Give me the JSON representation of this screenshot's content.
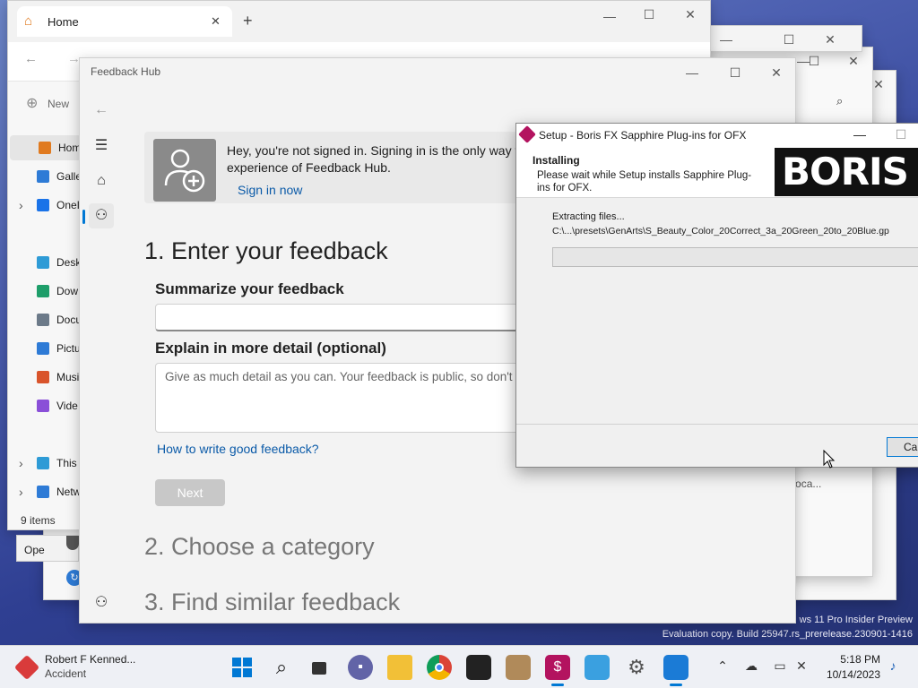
{
  "colors": {
    "accent": "#0078d4",
    "link": "#0a5aa8",
    "boris_bg": "#111111"
  },
  "explorer": {
    "tab_title": "Home",
    "new_label": "New",
    "sidebar": [
      {
        "label": "Home",
        "icon": "home-icon",
        "color": "#e07a1f"
      },
      {
        "label": "Galle",
        "icon": "gallery-icon",
        "color": "#2e7bd6"
      },
      {
        "label": "OneI",
        "icon": "onedrive-icon",
        "color": "#1a73e8"
      },
      {
        "label": "Desk",
        "icon": "desktop-icon",
        "color": "#2e9bd6"
      },
      {
        "label": "Dow",
        "icon": "download-icon",
        "color": "#1e9e6a"
      },
      {
        "label": "Docu",
        "icon": "documents-icon",
        "color": "#6c7a89"
      },
      {
        "label": "Pictu",
        "icon": "pictures-icon",
        "color": "#2e7bd6"
      },
      {
        "label": "Musi",
        "icon": "music-icon",
        "color": "#d9542b"
      },
      {
        "label": "Vide",
        "icon": "videos-icon",
        "color": "#8a4fd8"
      },
      {
        "label": "This",
        "icon": "this-pc-icon",
        "color": "#2e9bd6"
      },
      {
        "label": "Netw",
        "icon": "network-icon",
        "color": "#2e7bd6"
      }
    ],
    "status": "9 items",
    "open_label": "Ope",
    "path_fragment": "ta\\Loca..."
  },
  "watermark": {
    "line1": "ws 11 Pro Insider Preview",
    "line2": "Evaluation copy. Build 25947.rs_prerelease.230901-1416"
  },
  "feedback": {
    "title": "Feedback Hub",
    "banner_text": "Hey, you're not signed in. Signing in is the only way t",
    "banner_text2": "experience of Feedback Hub.",
    "sign_in": "Sign in now",
    "step1": "1. Enter your feedback",
    "summarize_label": "Summarize your feedback",
    "explain_label": "Explain in more detail (optional)",
    "explain_placeholder": "Give as much detail as you can. Your feedback is public, so don't",
    "how_to_link": "How to write good feedback?",
    "next_button": "Next",
    "step2": "2. Choose a category",
    "step3": "3. Find similar feedback"
  },
  "setup": {
    "title": "Setup - Boris FX Sapphire Plug-ins for OFX",
    "heading": "Installing",
    "subtext": "Please wait while Setup installs Sapphire Plug-ins for OFX.",
    "logo_text": "BORIS F",
    "status": "Extracting files...",
    "path": "C:\\...\\presets\\GenArts\\S_Beauty_Color_20Correct_3a_20Green_20to_20Blue.gp",
    "progress": 0,
    "cancel_button": "Can"
  },
  "taskbar": {
    "news_title": "Robert F Kenned...",
    "news_sub": "Accident",
    "time": "5:18 PM",
    "date": "10/14/2023"
  }
}
